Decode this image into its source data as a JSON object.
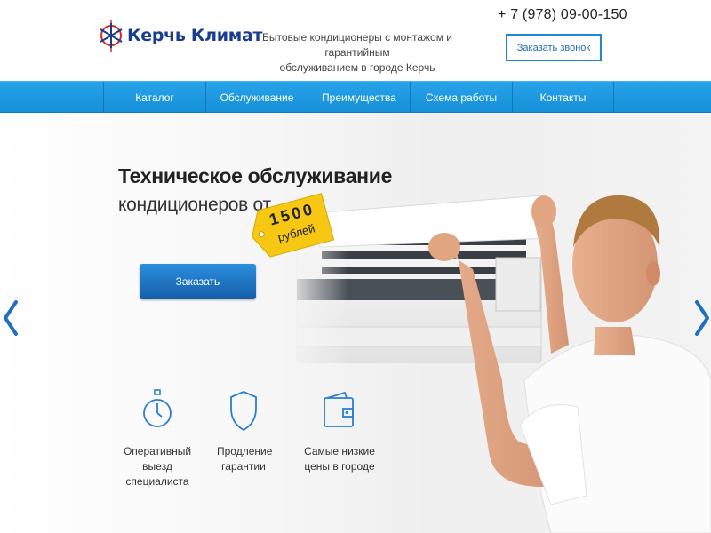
{
  "header": {
    "logo_text": "Керчь Климат",
    "tagline_line1": "Бытовые кондиционеры с монтажом и гарантийным",
    "tagline_line2": "обслуживанием в городе Керчь",
    "phone": "+ 7 (978) 09-00-150",
    "callback_label": "Заказать звонок",
    "logo_icon": "snowflake-sun-icon"
  },
  "nav": {
    "items": [
      {
        "label": "Каталог"
      },
      {
        "label": "Обслуживание"
      },
      {
        "label": "Преимущества"
      },
      {
        "label": "Схема работы"
      },
      {
        "label": "Контакты"
      }
    ]
  },
  "hero": {
    "title_line1": "Техническое обслуживание",
    "title_line2": "кондиционеров от",
    "price_value": "1500",
    "price_unit": "рублей",
    "order_label": "Заказать",
    "features": [
      {
        "icon": "stopwatch-icon",
        "line1": "Оперативный выезд",
        "line2": "специалиста"
      },
      {
        "icon": "shield-icon",
        "line1": "Продление",
        "line2": "гарантии"
      },
      {
        "icon": "wallet-icon",
        "line1": "Самые низкие",
        "line2": "цены в городе"
      }
    ]
  },
  "colors": {
    "brand_blue": "#1a3d8f",
    "nav_blue": "#1e98e0",
    "button_blue": "#1e6fbf",
    "price_tag_yellow": "#f6c814",
    "icon_blue": "#2a7fd0"
  }
}
